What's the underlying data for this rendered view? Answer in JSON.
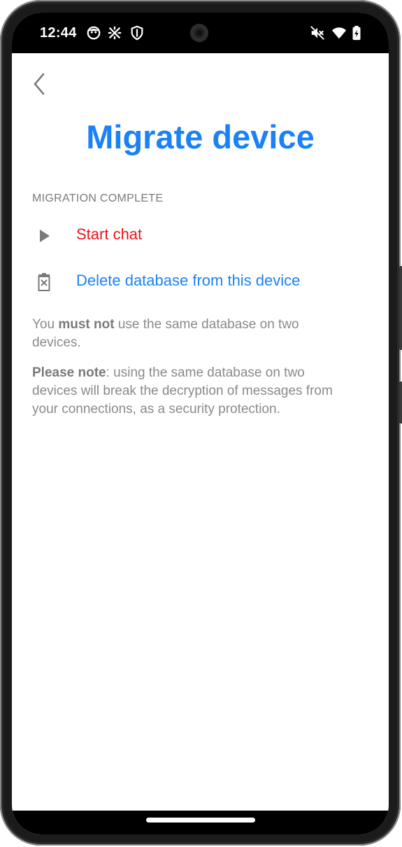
{
  "status_bar": {
    "time": "12:44",
    "icons": [
      "face-icon",
      "sync-icon",
      "vpn-shield-icon",
      "mute-icon",
      "wifi-icon",
      "battery-icon"
    ]
  },
  "header": {
    "back_icon": "chevron-left-icon",
    "title": "Migrate device"
  },
  "section": {
    "label": "MIGRATION COMPLETE"
  },
  "actions": [
    {
      "label": "Start chat",
      "icon": "play-icon",
      "color": "#e8141b"
    },
    {
      "label": "Delete database from this device",
      "icon": "delete-database-icon",
      "color": "#1a82f5"
    }
  ],
  "info": {
    "p1_pre": "You ",
    "p1_bold": "must not",
    "p1_post": " use the same database on two devices.",
    "p2_bold": "Please note",
    "p2_post": ": using the same database on two devices will break the decryption of messages from your connections, as a security protection."
  },
  "colors": {
    "accent": "#1a82f5",
    "danger": "#e8141b",
    "muted_text": "#8a8a8a"
  }
}
